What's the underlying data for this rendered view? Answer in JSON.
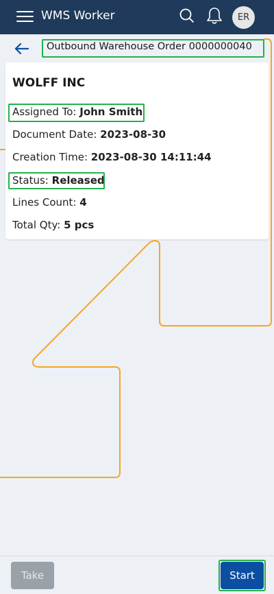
{
  "appbar": {
    "title": "WMS Worker",
    "avatar_initials": "ER",
    "icons": [
      "menu-icon",
      "search-icon",
      "bell-icon"
    ],
    "color": "#1f3a5a"
  },
  "page": {
    "title": "Outbound Warehouse Order 0000000040"
  },
  "card": {
    "company": "WOLFF INC",
    "fields": [
      {
        "label": "Assigned To:",
        "value": "John Smith"
      },
      {
        "label": "Document Date:",
        "value": "2023-08-30"
      },
      {
        "label": "Creation Time:",
        "value": "2023-08-30 14:11:44"
      },
      {
        "label": "Status:",
        "value": "Released"
      },
      {
        "label": "Lines Count:",
        "value": "4"
      },
      {
        "label": "Total Qty:",
        "value": "5 pcs"
      }
    ]
  },
  "footer": {
    "take_label": "Take",
    "start_label": "Start",
    "start_color": "#0b4ea2"
  },
  "annotation_colors": {
    "highlight": "#22b24c",
    "trace": "#f5a623"
  }
}
